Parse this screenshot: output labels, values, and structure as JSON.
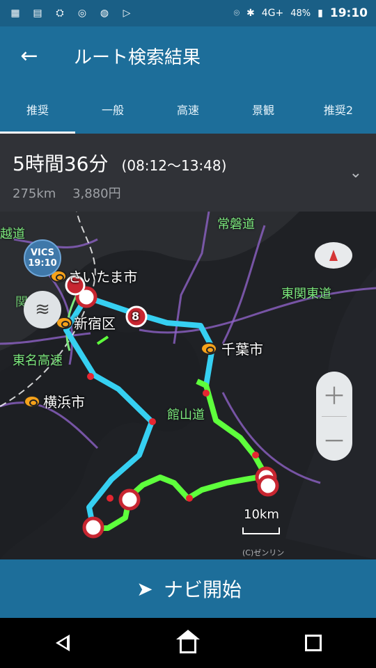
{
  "status_bar": {
    "icons": [
      "calendar-icon",
      "news-icon",
      "bike-icon",
      "instagram-icon",
      "line-icon",
      "play-store-icon"
    ],
    "network": "4G+",
    "battery": "48%",
    "time": "19:10"
  },
  "header": {
    "title": "ルート検索結果"
  },
  "tabs": [
    "推奨",
    "一般",
    "高速",
    "景観",
    "推奨2"
  ],
  "summary": {
    "duration": "5時間36分",
    "time_range": "(08:12〜13:48)",
    "distance": "275km",
    "toll": "3,880円"
  },
  "map": {
    "vics_label": "VICS",
    "vics_time": "19:10",
    "cities": [
      "さいたま市",
      "新宿区",
      "千葉市",
      "横浜市"
    ],
    "roads": [
      "常磐道",
      "東関東道",
      "東名高速",
      "館山道"
    ],
    "partial_labels": [
      "越道",
      "関越道"
    ],
    "route_marker": "8",
    "scale": "10km",
    "copyright": "(C)ゼンリン"
  },
  "actions": {
    "nav_start": "ナビ開始"
  },
  "colors": {
    "header": "#1d6e9a",
    "route_primary": "#36d0f2",
    "route_secondary": "#5eff3c"
  }
}
